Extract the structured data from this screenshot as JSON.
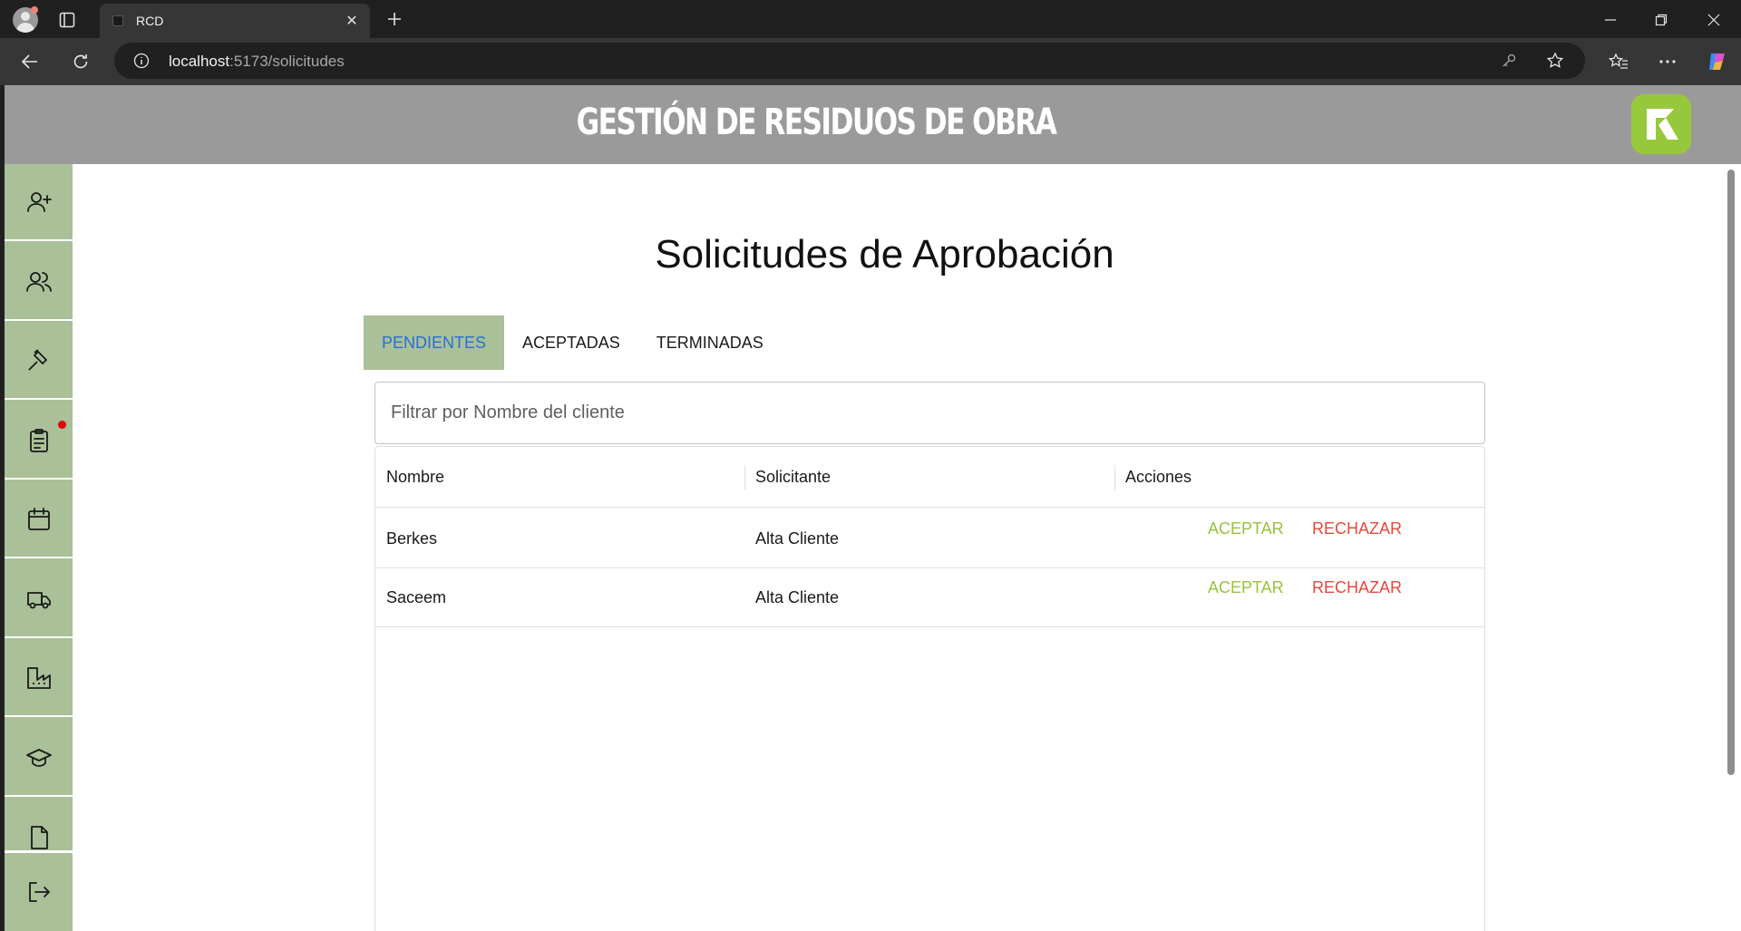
{
  "browser": {
    "tab_title": "RCD",
    "url_host": "localhost",
    "url_rest": ":5173/solicitudes"
  },
  "app": {
    "header_title": "GESTIÓN DE RESIDUOS DE OBRA",
    "logo_color": "#97c83c",
    "sidebar_color": "#a9c098",
    "sidebar_items": [
      {
        "icon": "add-user-icon"
      },
      {
        "icon": "users-icon"
      },
      {
        "icon": "hammer-icon"
      },
      {
        "icon": "clipboard-icon",
        "notification": true
      },
      {
        "icon": "calendar-icon"
      },
      {
        "icon": "truck-icon"
      },
      {
        "icon": "factory-icon"
      },
      {
        "icon": "graduation-cap-icon"
      },
      {
        "icon": "document-icon"
      },
      {
        "icon": "logout-icon"
      }
    ]
  },
  "main": {
    "page_title": "Solicitudes de Aprobación",
    "tabs": [
      {
        "label": "PENDIENTES",
        "active": true
      },
      {
        "label": "ACEPTADAS",
        "active": false
      },
      {
        "label": "TERMINADAS",
        "active": false
      }
    ],
    "filter": {
      "placeholder": "Filtrar por Nombre del cliente",
      "value": ""
    },
    "table": {
      "columns": [
        "Nombre",
        "Solicitante",
        "Acciones"
      ],
      "rows": [
        {
          "nombre": "Berkes",
          "solicitante": "Alta Cliente",
          "accept_label": "ACEPTAR",
          "reject_label": "RECHAZAR"
        },
        {
          "nombre": "Saceem",
          "solicitante": "Alta Cliente",
          "accept_label": "ACEPTAR",
          "reject_label": "RECHAZAR"
        }
      ]
    }
  }
}
